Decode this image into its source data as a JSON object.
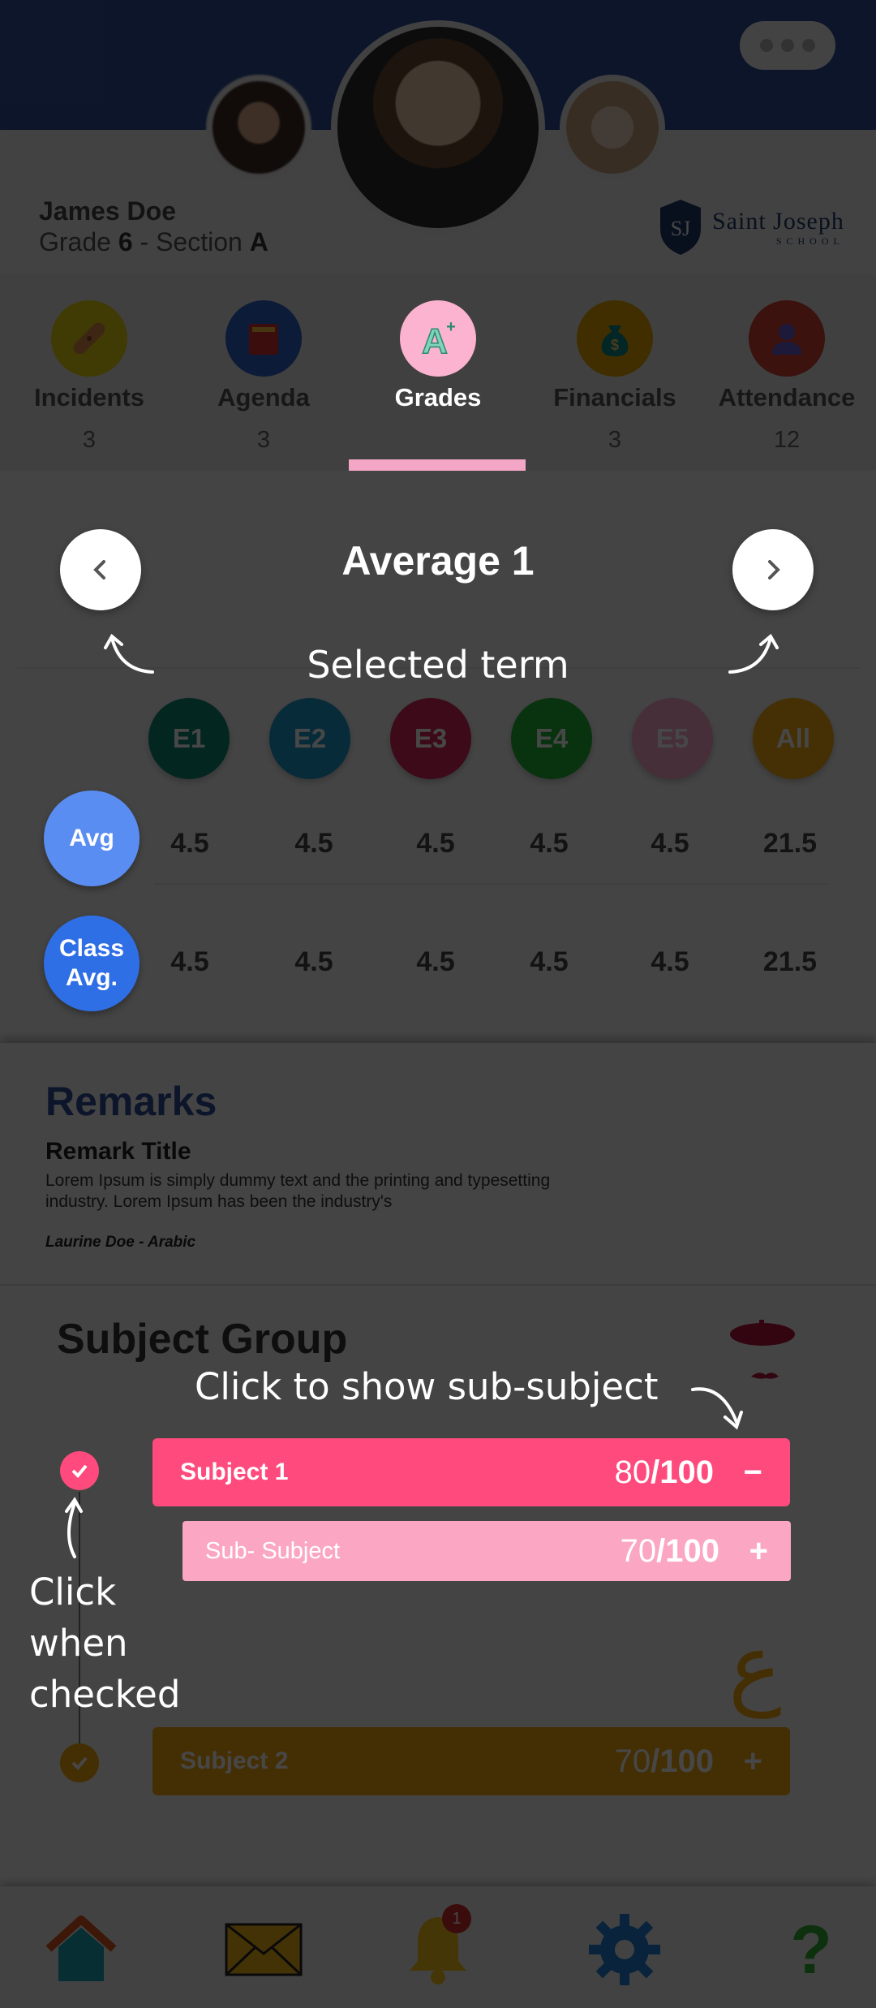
{
  "header": {
    "more_label": "•••",
    "student_name": "James Doe",
    "grade_prefix": "Grade ",
    "grade_value": "6",
    "section_prefix": " - Section ",
    "section_value": "A",
    "school_name": "Saint Joseph",
    "school_sub": "SCHOOL",
    "school_monogram": "SJ"
  },
  "tabs": [
    {
      "label": "Incidents",
      "count": "3",
      "icon": "bandage-icon",
      "color": "#e5cf10"
    },
    {
      "label": "Agenda",
      "count": "3",
      "icon": "book-icon",
      "color": "#2d63c8"
    },
    {
      "label": "Grades",
      "count": "",
      "icon": "grade-a-plus-icon",
      "color": "#fbb3cf",
      "active": true
    },
    {
      "label": "Financials",
      "count": "3",
      "icon": "money-bag-icon",
      "color": "#e6a500"
    },
    {
      "label": "Attendance",
      "count": "12",
      "icon": "person-icon",
      "color": "#d2402f"
    }
  ],
  "grades": {
    "term_title": "Average 1",
    "hint_selected_term": "Selected term",
    "exams": [
      {
        "label": "E1",
        "color": "#0f8a75"
      },
      {
        "label": "E2",
        "color": "#1f9bd0"
      },
      {
        "label": "E3",
        "color": "#d8255a"
      },
      {
        "label": "E4",
        "color": "#23b237"
      },
      {
        "label": "E5",
        "color": "#f9a8c8"
      },
      {
        "label": "All",
        "color": "#f6a90f"
      }
    ],
    "rows": [
      {
        "label": "Avg",
        "color": "#5a8df2",
        "values": [
          "4.5",
          "4.5",
          "4.5",
          "4.5",
          "4.5",
          "21.5"
        ]
      },
      {
        "label_line1": "Class",
        "label_line2": "Avg.",
        "color": "#2f6fe6",
        "values": [
          "4.5",
          "4.5",
          "4.5",
          "4.5",
          "4.5",
          "21.5"
        ]
      }
    ]
  },
  "remarks": {
    "title": "Remarks",
    "remark_title": "Remark Title",
    "body": "Lorem Ipsum is simply dummy text and the printing and typesetting industry. Lorem Ipsum has been the industry's",
    "author": "Laurine Doe - Arabic"
  },
  "subjects": {
    "group_title": "Subject Group",
    "hint_sub_subject": "Click to show sub-subject",
    "hint_check_line1": "Click",
    "hint_check_line2": "when",
    "hint_check_line3": "checked",
    "items": [
      {
        "name": "Subject 1",
        "score": "80",
        "total": "/100",
        "toggle": "−",
        "color": "#ff4a7d"
      },
      {
        "name": "Sub- Subject",
        "score": "70",
        "total": "/100",
        "toggle": "+",
        "color": "#fba7c3"
      },
      {
        "name": "Subject 2",
        "score": "70",
        "total": "/100",
        "toggle": "+",
        "color": "#f2a812"
      }
    ],
    "subject_icon_arabic": "ع"
  },
  "bottom_nav": {
    "items": [
      "home-icon",
      "mail-icon",
      "bell-icon",
      "settings-icon",
      "help-icon"
    ],
    "notification_count": "1",
    "help_glyph": "?"
  }
}
